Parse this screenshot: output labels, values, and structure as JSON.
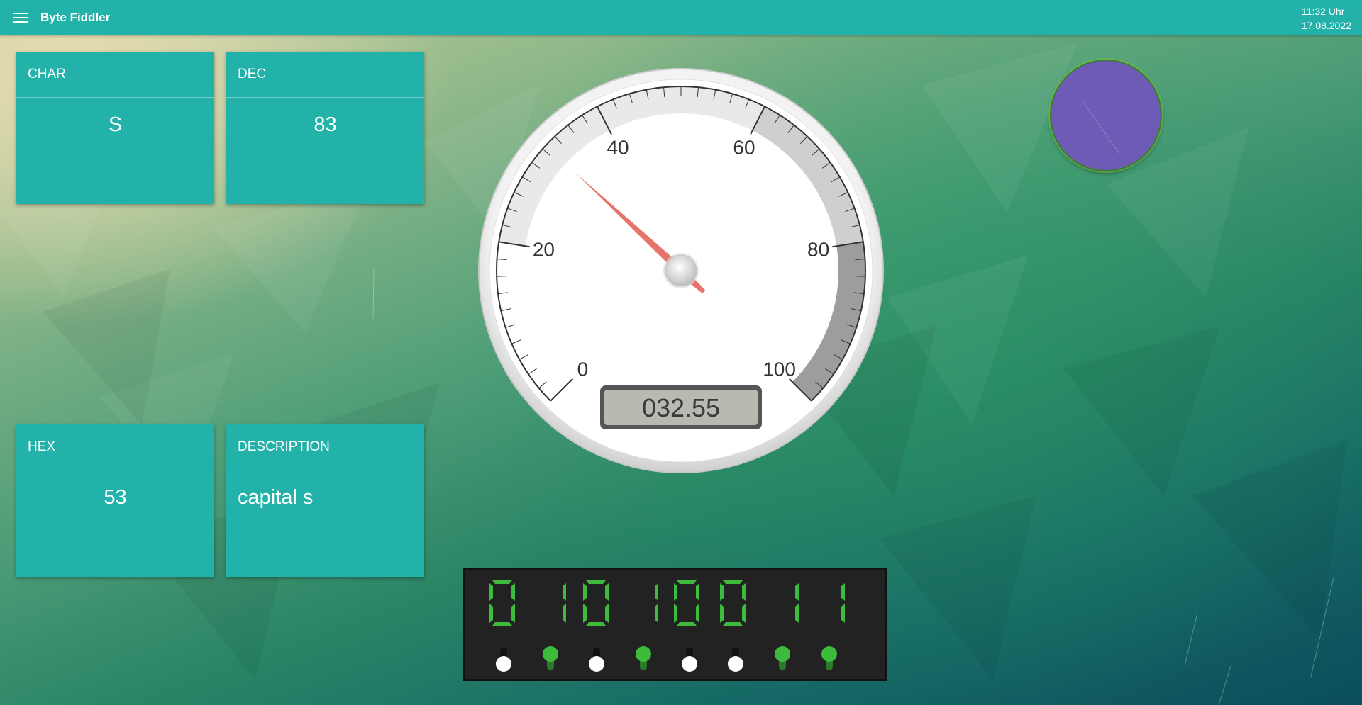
{
  "app": {
    "title": "Byte Fiddler",
    "time": "11:32 Uhr",
    "date": "17.08.2022"
  },
  "cards": {
    "char": {
      "label": "CHAR",
      "value": "S"
    },
    "dec": {
      "label": "DEC",
      "value": "83"
    },
    "hex": {
      "label": "HEX",
      "value": "53"
    },
    "description": {
      "label": "DESCRIPTION",
      "value": "capital s"
    }
  },
  "gauge": {
    "min": 0,
    "max": 100,
    "value": 32.55,
    "display": "032.55",
    "labels": [
      "0",
      "20",
      "40",
      "60",
      "80",
      "100"
    ],
    "colors": {
      "needle": "#e8736b",
      "zone_light": "#e9e9e9",
      "zone_mid": "#cfcfcf",
      "zone_dark": "#9d9d9d"
    }
  },
  "binary": {
    "digits": [
      "0",
      "1",
      "0",
      "1",
      "0",
      "0",
      "1",
      "1"
    ],
    "switches": [
      false,
      true,
      false,
      true,
      false,
      false,
      true,
      true
    ],
    "segment_color": "#3dbb3d"
  },
  "knob": {
    "color": "#6e5bb5"
  }
}
